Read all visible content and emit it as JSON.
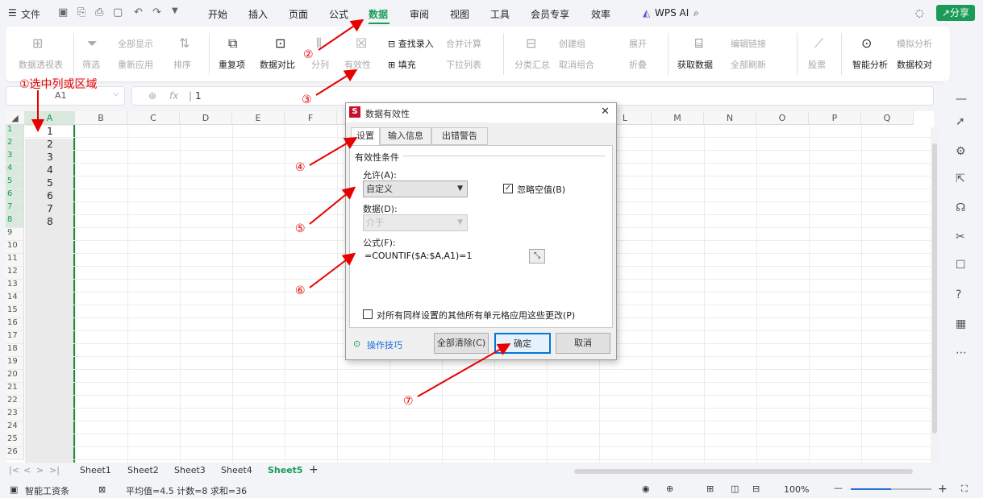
{
  "menubar": {
    "file": "文件",
    "tabs": [
      "开始",
      "插入",
      "页面",
      "公式",
      "数据",
      "审阅",
      "视图",
      "工具",
      "会员专享",
      "效率"
    ],
    "active_tab": "数据",
    "wps_ai": "WPS AI",
    "share": "分享"
  },
  "ribbon": {
    "pivot": "数据透视表",
    "filter": "筛选",
    "show_all": "全部显示",
    "reapply": "重新应用",
    "sort": "排序",
    "duplicates": "重复项",
    "compare": "数据对比",
    "split": "分列",
    "validity": "有效性",
    "lookup": "查找录入",
    "fill": "填充",
    "consolidate": "合并计算",
    "dropdown": "下拉列表",
    "subtotal": "分类汇总",
    "create_group": "创建组",
    "ungroup": "取消组合",
    "expand": "展开",
    "collapse": "折叠",
    "get_data": "获取数据",
    "edit_links": "编辑链接",
    "refresh_all": "全部刷新",
    "stocks": "股票",
    "smart_analysis": "智能分析",
    "what_if": "模拟分析",
    "data_check": "数据校对"
  },
  "formula_bar": {
    "cell_ref": "A1",
    "fx": "fx",
    "value": "1"
  },
  "sheet": {
    "columns": [
      "A",
      "B",
      "C",
      "D",
      "E",
      "F",
      "G",
      "H",
      "I",
      "J",
      "K",
      "L",
      "M",
      "N",
      "O",
      "P",
      "Q"
    ],
    "rows": [
      "1",
      "2",
      "3",
      "4",
      "5",
      "6",
      "7",
      "8",
      "9",
      "10",
      "11",
      "12",
      "13",
      "14",
      "15",
      "16",
      "17",
      "18",
      "19",
      "20",
      "21",
      "22",
      "23",
      "24",
      "25",
      "26"
    ],
    "column_a_values": [
      "1",
      "2",
      "3",
      "4",
      "5",
      "6",
      "7",
      "8"
    ]
  },
  "sheet_tabs": [
    "Sheet1",
    "Sheet2",
    "Sheet3",
    "Sheet4",
    "Sheet5"
  ],
  "active_sheet": "Sheet5",
  "status": {
    "smart_tool": "智能工资条",
    "stats": "平均值=4.5  计数=8  求和=36",
    "zoom": "100%"
  },
  "dialog": {
    "title": "数据有效性",
    "tabs": [
      "设置",
      "输入信息",
      "出错警告"
    ],
    "active_tab": "设置",
    "group_label": "有效性条件",
    "allow_label": "允许(A):",
    "allow_value": "自定义",
    "ignore_blank": "忽略空值(B)",
    "data_label": "数据(D):",
    "data_value": "介于",
    "formula_label": "公式(F):",
    "formula_value": "=COUNTIF($A:$A,A1)=1",
    "apply_all": "对所有同样设置的其他所有单元格应用这些更改(P)",
    "tips": "操作技巧",
    "clear_all": "全部清除(C)",
    "ok": "确定",
    "cancel": "取消"
  },
  "annotations": {
    "step1": "①选中列或区域",
    "step2": "②",
    "step3": "③",
    "step4": "④",
    "step5": "⑤",
    "step6": "⑥",
    "step7": "⑦"
  },
  "colors": {
    "accent": "#1a9b57",
    "annotation": "#e60000",
    "selection": "#1e8c3a"
  }
}
